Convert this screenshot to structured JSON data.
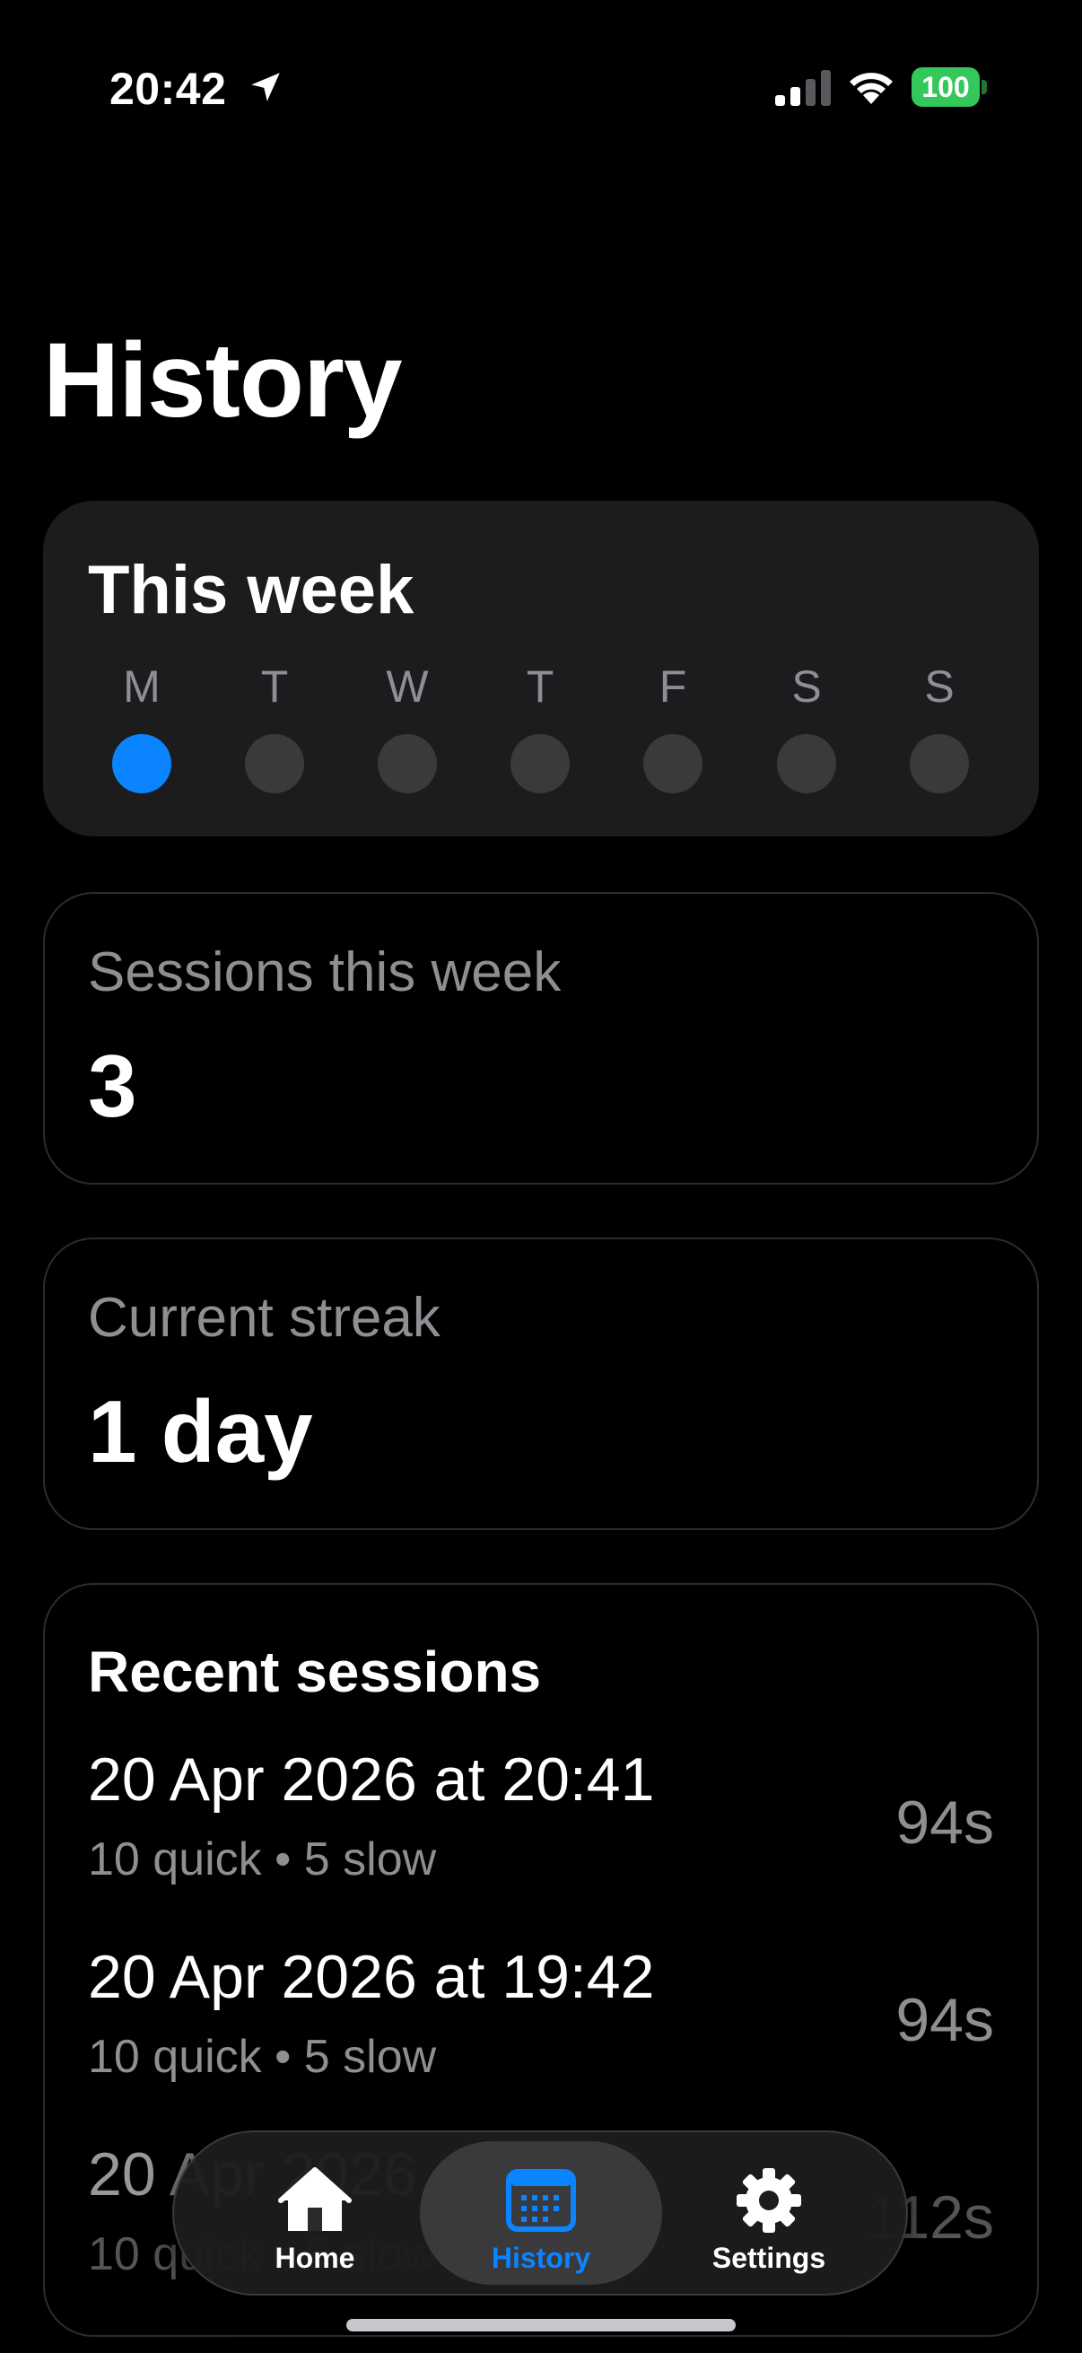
{
  "status_bar": {
    "time": "20:42",
    "battery": "100",
    "icons": [
      "location-arrow-icon",
      "cellular-signal-icon",
      "wifi-icon",
      "battery-icon"
    ]
  },
  "page": {
    "title": "History"
  },
  "this_week": {
    "title": "This week",
    "days": [
      {
        "label": "M",
        "completed": true
      },
      {
        "label": "T",
        "completed": false
      },
      {
        "label": "W",
        "completed": false
      },
      {
        "label": "T",
        "completed": false
      },
      {
        "label": "F",
        "completed": false
      },
      {
        "label": "S",
        "completed": false
      },
      {
        "label": "S",
        "completed": false
      }
    ],
    "active_color": "#0a84ff"
  },
  "sessions_this_week": {
    "label": "Sessions this week",
    "value": "3"
  },
  "current_streak": {
    "label": "Current streak",
    "value": "1 day"
  },
  "recent_sessions": {
    "title": "Recent sessions",
    "items": [
      {
        "date": "20 Apr 2026 at 20:41",
        "detail": "10 quick • 5 slow",
        "duration": "94s"
      },
      {
        "date": "20 Apr 2026 at 19:42",
        "detail": "10 quick • 5 slow",
        "duration": "94s"
      },
      {
        "date": "20 Apr 2026 at 19:11",
        "detail": "10 quick • 5 slow",
        "duration": "112s"
      }
    ]
  },
  "tab_bar": {
    "tabs": [
      {
        "label": "Home",
        "icon": "house-icon",
        "selected": false
      },
      {
        "label": "History",
        "icon": "calendar-icon",
        "selected": true
      },
      {
        "label": "Settings",
        "icon": "gear-icon",
        "selected": false
      }
    ],
    "selected_color": "#0a84ff"
  }
}
